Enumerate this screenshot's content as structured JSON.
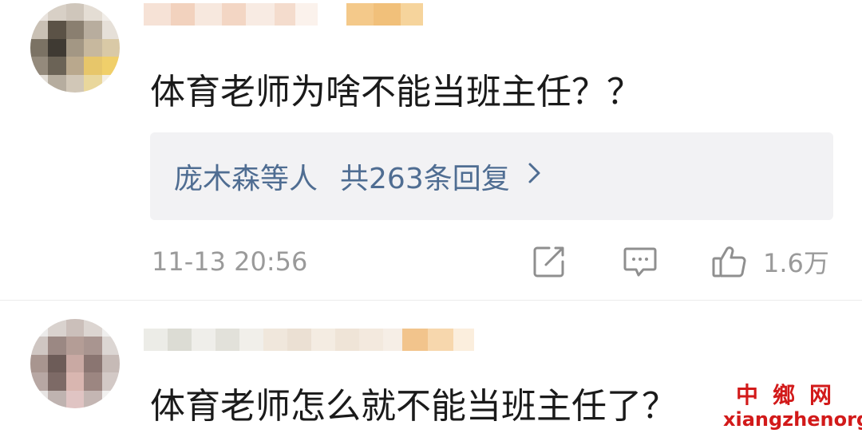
{
  "comments": [
    {
      "text": "体育老师为啥不能当班主任？？",
      "replies": {
        "who": "庞木森等人",
        "count_text": "共263条回复"
      },
      "timestamp": "11-13 20:56",
      "likes": "1.6万"
    },
    {
      "text": "体育老师怎么就不能当班主任了？"
    }
  ],
  "watermark": {
    "chinese": "中鄉网",
    "domain": "xiangzhenorg"
  },
  "icons": {
    "share": "edit-share-icon",
    "comment": "comment-bubble-icon",
    "like": "thumbs-up-icon",
    "chevron": "chevron-right-icon"
  },
  "colors": {
    "link_blue": "#4f6d92",
    "meta_gray": "#9a9a9a",
    "text": "#1a1a1a",
    "watermark_red": "#d21a1a",
    "replies_bg": "#f2f2f4"
  }
}
